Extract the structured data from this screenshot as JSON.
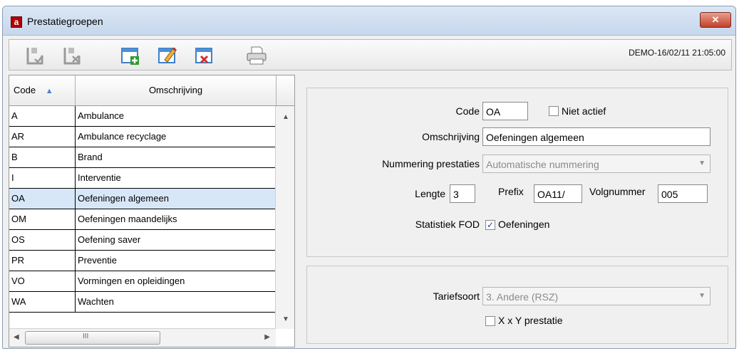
{
  "window": {
    "title": "Prestatiegroepen",
    "app_icon_letter": "a",
    "close_glyph": "✕"
  },
  "toolbar": {
    "status": "DEMO-16/02/11 21:05:00",
    "buttons": [
      {
        "icon": "save-check-icon",
        "enabled": false
      },
      {
        "icon": "save-cancel-icon",
        "enabled": false
      },
      {
        "icon": "new-record-icon",
        "enabled": true
      },
      {
        "icon": "edit-record-icon",
        "enabled": true
      },
      {
        "icon": "delete-record-icon",
        "enabled": true
      },
      {
        "icon": "print-icon",
        "enabled": true
      }
    ]
  },
  "grid": {
    "columns": [
      "Code",
      "Omschrijving"
    ],
    "sort_column": "Code",
    "sort_glyph": "▲",
    "rows": [
      {
        "code": "A",
        "omschrijving": "Ambulance"
      },
      {
        "code": "AR",
        "omschrijving": "Ambulance recyclage"
      },
      {
        "code": "B",
        "omschrijving": "Brand"
      },
      {
        "code": "I",
        "omschrijving": "Interventie"
      },
      {
        "code": "OA",
        "omschrijving": "Oefeningen algemeen"
      },
      {
        "code": "OM",
        "omschrijving": "Oefeningen maandelijks"
      },
      {
        "code": "OS",
        "omschrijving": "Oefening saver"
      },
      {
        "code": "PR",
        "omschrijving": "Preventie"
      },
      {
        "code": "VO",
        "omschrijving": "Vormingen en opleidingen"
      },
      {
        "code": "WA",
        "omschrijving": "Wachten"
      }
    ],
    "selected_index": 4,
    "hscroll_thumb_glyph": "III"
  },
  "form": {
    "code_label": "Code",
    "code_value": "OA",
    "niet_actief_label": "Niet actief",
    "niet_actief_checked": false,
    "omschrijving_label": "Omschrijving",
    "omschrijving_value": "Oefeningen algemeen",
    "nummering_label": "Nummering prestaties",
    "nummering_value": "Automatische nummering",
    "lengte_label": "Lengte",
    "lengte_value": "3",
    "prefix_label": "Prefix",
    "prefix_value": "OA11/",
    "volgnummer_label": "Volgnummer",
    "volgnummer_value": "005",
    "statistiek_label": "Statistiek FOD",
    "oefeningen_label": "Oefeningen",
    "oefeningen_checked": true,
    "tariefsoort_label": "Tariefsoort",
    "tariefsoort_value": "3. Andere (RSZ)",
    "xy_label": "X x Y prestatie",
    "xy_checked": false,
    "check_glyph": "✓"
  }
}
